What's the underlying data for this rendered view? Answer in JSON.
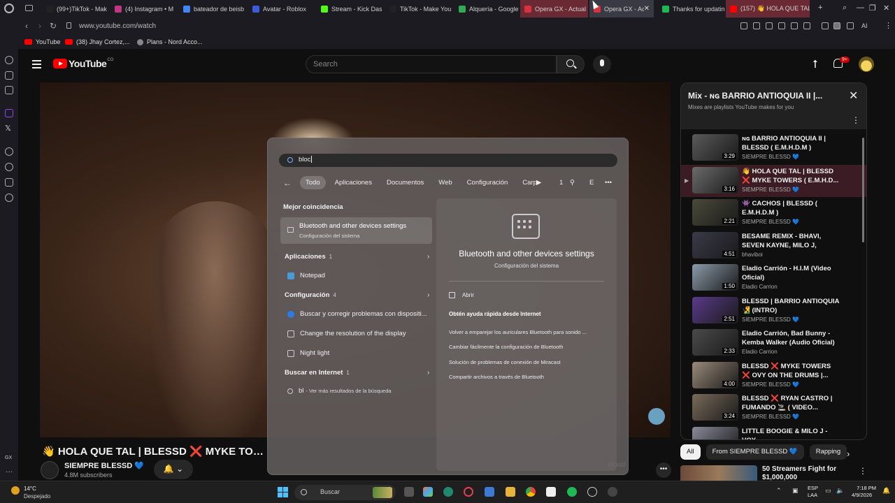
{
  "browser": {
    "tabs": [
      {
        "title": "(99+)TikTok - Mak",
        "icon": "tiktok-icon",
        "color": "#222222"
      },
      {
        "title": "(4) Instagram • M",
        "icon": "instagram-icon",
        "color": "#c13584"
      },
      {
        "title": "bateador de beisb",
        "icon": "google-icon",
        "color": "#4285f4"
      },
      {
        "title": "Avatar - Roblox",
        "icon": "roblox-icon",
        "color": "#3b5bdb"
      },
      {
        "title": "Stream - Kick Das",
        "icon": "kick-icon",
        "color": "#53fc18"
      },
      {
        "title": "TikTok - Make You",
        "icon": "tiktok-icon",
        "color": "#222222"
      },
      {
        "title": "Alquería - Google",
        "icon": "maps-pin-icon",
        "color": "#34a853"
      },
      {
        "title": "Opera GX - Actual",
        "icon": "opera-gx-icon",
        "color": "#d6333e"
      },
      {
        "title": "Opera GX - Ac",
        "icon": "opera-gx-icon",
        "color": "#d6333e"
      },
      {
        "title": "Thanks for updatin",
        "icon": "shield-icon",
        "color": "#1db954"
      },
      {
        "title": "(157) 👋 HOLA QUE TAL |",
        "icon": "youtube-icon",
        "color": "#ff0000"
      }
    ],
    "new_tab": "+",
    "url": "www.youtube.com/watch",
    "ai_label": "AI",
    "bookmarks": [
      {
        "label": "YouTube"
      },
      {
        "label": "(38) Jhay Cortez,..."
      },
      {
        "label": "Plans - Nord Acco..."
      }
    ],
    "rail_label": "GX"
  },
  "youtube": {
    "logo": "YouTube",
    "country": "CO",
    "search_placeholder": "Search",
    "notif_badge": "9+",
    "video_title": "👋 HOLA QUE TAL | BLESSD ❌ MYKE TOWERS ( E.M.",
    "channel_name": "SIEMPRE BLESSD 💙",
    "channel_subs": "4.8M subscribers",
    "download_label": "nload",
    "more_label": "•••",
    "playlist": {
      "title": "Mix - ɴɢ BARRIO ANTIOQUIA II |...",
      "subtitle": "Mixes are playlists YouTube makes for you",
      "items": [
        {
          "title": "ɴɢ BARRIO ANTIOQUIA II | BLESSD ( E.M.H.D.M )",
          "channel": "SIEMPRE BLESSD 💙",
          "duration": "3:29",
          "current": false,
          "thumb": "#5a5a5a"
        },
        {
          "title": "👋 HOLA QUE TAL | BLESSD ❌ MYKE TOWERS ( E.M.H.D...",
          "channel": "SIEMPRE BLESSD 💙",
          "duration": "3:16",
          "current": true,
          "thumb": "#6b6b6b"
        },
        {
          "title": "👾 CACHOS | BLESSD ( E.M.H.D.M )",
          "channel": "SIEMPRE BLESSD 💙",
          "duration": "2:21",
          "current": false,
          "thumb": "#4a4a3a"
        },
        {
          "title": "BESAME REMIX - BHAVI, SEVEN KAYNE, MILO J, TIAG...",
          "channel": "bhaviboi",
          "duration": "4:51",
          "current": false,
          "thumb": "#3a3a4a"
        },
        {
          "title": "Eladio Carrión - H.I.M (Video Oficial)",
          "channel": "Eladio Carrion",
          "duration": "1:50",
          "current": false,
          "thumb": "#8a9aaa"
        },
        {
          "title": "BLESSD | BARRIO ANTIOQUIA 🧏‍♂️ (INTRO)",
          "channel": "SIEMPRE BLESSD 💙",
          "duration": "2:51",
          "current": false,
          "thumb": "#5a3a8a"
        },
        {
          "title": "Eladio Carrión, Bad Bunny - Kemba Walker (Audio Oficial)",
          "channel": "Eladio Carrion",
          "duration": "2:33",
          "current": false,
          "thumb": "#4a4a4a"
        },
        {
          "title": "BLESSD ❌ MYKE TOWERS ❌ OVY ON THE DRUMS |...",
          "channel": "SIEMPRE BLESSD 💙",
          "duration": "4:00",
          "current": false,
          "thumb": "#9a8a7a"
        },
        {
          "title": "BLESSD ❌ RYAN CASTRO | FUMANDO 🚬 ( VIDEO...",
          "channel": "SIEMPRE BLESSD 💙",
          "duration": "3:24",
          "current": false,
          "thumb": "#7a6a5a"
        },
        {
          "title": "LITTLE BOOGIE & MILO J - VOY",
          "channel": "",
          "duration": "",
          "current": false,
          "thumb": "#8a8a9a"
        }
      ]
    },
    "chips": [
      "All",
      "From SIEMPRE BLESSD 💙",
      "Rapping"
    ],
    "rec_title": "50 Streamers Fight for $1,000,000"
  },
  "start_menu": {
    "query": "bloc",
    "filters": [
      "Todo",
      "Aplicaciones",
      "Documentos",
      "Web",
      "Configuración",
      "Carp"
    ],
    "filters_right": [
      "1",
      "E",
      "•••"
    ],
    "best_match_header": "Mejor coincidencia",
    "best_match": {
      "title": "Bluetooth and other devices settings",
      "subtitle": "Configuración del sistema"
    },
    "apps_header": "Aplicaciones",
    "apps_count": "1",
    "apps": [
      {
        "label": "Notepad",
        "color": "#4a9ad6"
      }
    ],
    "settings_header": "Configuración",
    "settings_count": "4",
    "settings": [
      {
        "label": "Buscar y corregir problemas con dispositi...",
        "color": "#2d7be5"
      },
      {
        "label": "Change the resolution of the display",
        "color": "#9a9a9a"
      },
      {
        "label": "Night light",
        "color": "#9a9a9a"
      }
    ],
    "web_header": "Buscar en Internet",
    "web_count": "1",
    "web_result": {
      "query": "bl",
      "hint": "- Ver más resultados de la búsqueda"
    },
    "detail": {
      "title": "Bluetooth and other devices settings",
      "subtitle": "Configuración del sistema",
      "open": "Abrir",
      "help_header": "Obtén ayuda rápida desde Internet",
      "links": [
        "Volver a emparejar los auriculares Bluetooth para sonido ...",
        "Cambiar fácilmente la configuración de Bluetooth",
        "Solución de problemas de conexión de Miracast",
        "Compartir archivos a través de Bluetooth"
      ]
    }
  },
  "taskbar": {
    "temp": "14°C",
    "condition": "Despejado",
    "search_label": "Buscar",
    "lang": "ESP",
    "region": "LAA",
    "time": "7:18 PM",
    "date": "4/9/2026"
  }
}
